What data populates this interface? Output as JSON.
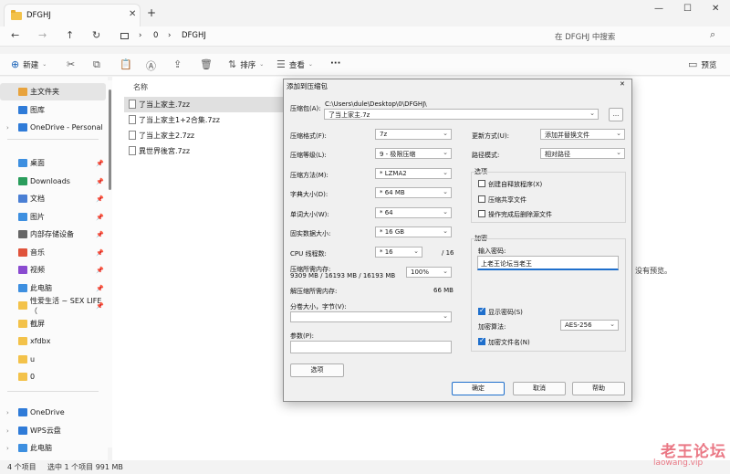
{
  "window": {
    "tab_title": "DFGHJ"
  },
  "address": {
    "crumbs": [
      "0",
      "DFGHJ"
    ],
    "search_placeholder": "在 DFGHJ 中搜索"
  },
  "toolbar": {
    "new_label": "新建",
    "sort_label": "排序",
    "view_label": "查看",
    "more_label": "···",
    "preview_label": "预览"
  },
  "sidebar": {
    "items": [
      {
        "label": "主文件夹",
        "color": "#e8a33d"
      },
      {
        "label": "图库",
        "color": "#2f7bd8"
      },
      {
        "label": "OneDrive - Personal",
        "color": "#2f7bd8"
      },
      {
        "label": "桌面",
        "color": "#3d8fe0"
      },
      {
        "label": "Downloads",
        "color": "#2a9d5c"
      },
      {
        "label": "文档",
        "color": "#4a7fd4"
      },
      {
        "label": "图片",
        "color": "#3d8fe0"
      },
      {
        "label": "内部存储设备",
        "color": "#666666"
      },
      {
        "label": "音乐",
        "color": "#e0533b"
      },
      {
        "label": "视频",
        "color": "#8a4bd0"
      },
      {
        "label": "此电脑",
        "color": "#3d8fe0"
      },
      {
        "label": "性爱生活 ~ SEX LIFE（",
        "color": "#f3c24a"
      },
      {
        "label": "截屏",
        "color": "#f3c24a"
      },
      {
        "label": "xfdbx",
        "color": "#f3c24a"
      },
      {
        "label": "u",
        "color": "#f3c24a"
      },
      {
        "label": "0",
        "color": "#f3c24a"
      },
      {
        "label": "OneDrive",
        "color": "#2f7bd8"
      },
      {
        "label": "WPS云盘",
        "color": "#2f7bd8"
      },
      {
        "label": "此电脑",
        "color": "#3d8fe0"
      }
    ]
  },
  "files": {
    "column_name": "名称",
    "items": [
      "了当上家主.7zz",
      "了当上家主1+2合集.7zz",
      "了当上家主2.7zz",
      "異世界後宮.7zz"
    ]
  },
  "preview_text": "没有预览。",
  "status": {
    "count": "4 个项目",
    "selected": "选中 1 个项目  991 MB"
  },
  "watermark": {
    "title": "老王论坛",
    "url": "laowang.vip"
  },
  "dialog": {
    "title": "添加到压缩包",
    "archive_label": "压缩包(A):",
    "archive_path": "C:\\Users\\dule\\Desktop\\0\\DFGHJ\\",
    "archive_name": "了当上家主.7z",
    "browse": "...",
    "format_label": "压缩格式(F):",
    "format_value": "7z",
    "level_label": "压缩等级(L):",
    "level_value": "9 - 极限压缩",
    "method_label": "压缩方法(M):",
    "method_value": "* LZMA2",
    "dict_label": "字典大小(D):",
    "dict_value": "* 64 MB",
    "word_label": "单词大小(W):",
    "word_value": "* 64",
    "solid_label": "固实数据大小:",
    "solid_value": "* 16 GB",
    "cpu_label": "CPU 线程数:",
    "cpu_value": "* 16",
    "cpu_total": "/ 16",
    "mem_label": "压缩所需内存:",
    "mem_detail": "9309 MB / 16193 MB / 16193 MB",
    "mem_pct": "100%",
    "decomp_label": "解压缩所需内存:",
    "decomp_value": "66 MB",
    "split_label": "分卷大小，字节(V):",
    "params_label": "参数(P):",
    "options_btn": "选项",
    "update_label": "更新方式(U):",
    "update_value": "添加并替换文件",
    "path_label": "路径模式:",
    "path_value": "相对路径",
    "opts_group": "选项",
    "opt1": "创建自释放程序(X)",
    "opt2": "压缩共享文件",
    "opt3": "操作完成后删除源文件",
    "enc_group": "加密",
    "pwd_label": "输入密码:",
    "pwd_value": "上老王论坛当老王",
    "show_pwd": "显示密码(S)",
    "enc_method_label": "加密算法:",
    "enc_method_value": "AES-256",
    "enc_names": "加密文件名(N)",
    "ok": "确定",
    "cancel": "取消",
    "help": "帮助"
  }
}
